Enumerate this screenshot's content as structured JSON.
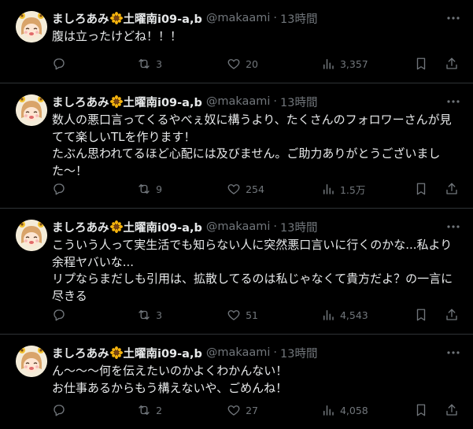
{
  "tweets": [
    {
      "display_name": "ましろあみ",
      "display_name_suffix": "土曜南i09-a,b",
      "handle": "@makaami",
      "time": "13時間",
      "text": "腹は立ったけどね！！！",
      "replies": "",
      "retweets": "3",
      "likes": "20",
      "views": "3,357"
    },
    {
      "display_name": "ましろあみ",
      "display_name_suffix": "土曜南i09-a,b",
      "handle": "@makaami",
      "time": "13時間",
      "text": "数人の悪口言ってくるやべぇ奴に構うより、たくさんのフォロワーさんが見てて楽しいTLを作ります！\nたぶん思われてるほど心配には及びません。ご助力ありがとうございました〜！",
      "replies": "",
      "retweets": "9",
      "likes": "254",
      "views": "1.5万"
    },
    {
      "display_name": "ましろあみ",
      "display_name_suffix": "土曜南i09-a,b",
      "handle": "@makaami",
      "time": "13時間",
      "text": "こういう人って実生活でも知らない人に突然悪口言いに行くのかな...私より余程ヤバいな...\nリプならまだしも引用は、拡散してるのは私じゃなくて貴方だよ？の一言に尽きる",
      "replies": "",
      "retweets": "3",
      "likes": "51",
      "views": "4,543"
    },
    {
      "display_name": "ましろあみ",
      "display_name_suffix": "土曜南i09-a,b",
      "handle": "@makaami",
      "time": "13時間",
      "text": "ん〜〜〜何を伝えたいのかよくわかんない！\nお仕事あるからもう構えないや、ごめんね！",
      "replies": "",
      "retweets": "2",
      "likes": "27",
      "views": "4,058"
    }
  ],
  "icons": {
    "more": "more-icon",
    "reply": "reply-icon",
    "retweet": "retweet-icon",
    "like": "heart-icon",
    "views": "views-icon",
    "bookmark": "bookmark-icon",
    "share": "share-icon",
    "name_emoji": "sunflower-icon"
  },
  "colors": {
    "background": "#000000",
    "text": "#e7e9ea",
    "muted": "#71767b",
    "divider": "#2f3336"
  }
}
